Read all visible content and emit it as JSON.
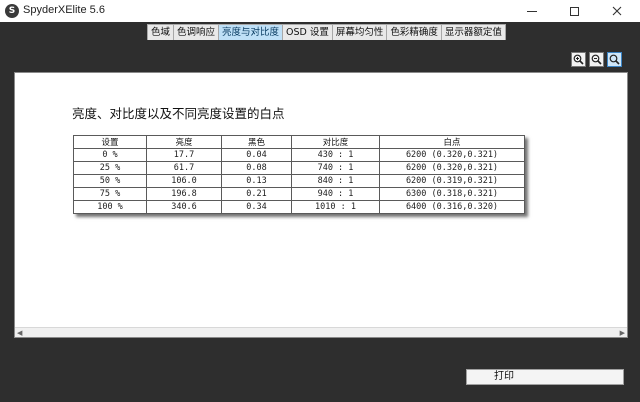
{
  "window": {
    "title": "SpyderXElite 5.6",
    "app_icon": "S"
  },
  "tabs": [
    {
      "label": "色域",
      "active": false
    },
    {
      "label": "色调响应",
      "active": false
    },
    {
      "label": "亮度与对比度",
      "active": true
    },
    {
      "label": "OSD 设置",
      "active": false
    },
    {
      "label": "屏幕均匀性",
      "active": false
    },
    {
      "label": "色彩精确度",
      "active": false
    },
    {
      "label": "显示器额定值",
      "active": false
    }
  ],
  "panel": {
    "title": "亮度、对比度以及不同亮度设置的白点",
    "zoom_icons": [
      "zoom-in-icon",
      "zoom-out-icon",
      "zoom-fit-icon"
    ]
  },
  "table": {
    "headers": [
      "设置",
      "亮度",
      "黑色",
      "对比度",
      "白点"
    ],
    "rows": [
      [
        "0 %",
        "17.7",
        "0.04",
        "430 : 1",
        "6200 (0.320,0.321)"
      ],
      [
        "25 %",
        "61.7",
        "0.08",
        "740 : 1",
        "6200 (0.320,0.321)"
      ],
      [
        "50 %",
        "106.0",
        "0.13",
        "840 : 1",
        "6200 (0.319,0.321)"
      ],
      [
        "75 %",
        "196.8",
        "0.21",
        "940 : 1",
        "6300 (0.318,0.321)"
      ],
      [
        "100 %",
        "340.6",
        "0.34",
        "1010 : 1",
        "6400 (0.316,0.320)"
      ]
    ]
  },
  "footer": {
    "print_label": "打印"
  },
  "colors": {
    "active_tab": "#bfe0f7",
    "window_bg": "#2e2e2e"
  }
}
